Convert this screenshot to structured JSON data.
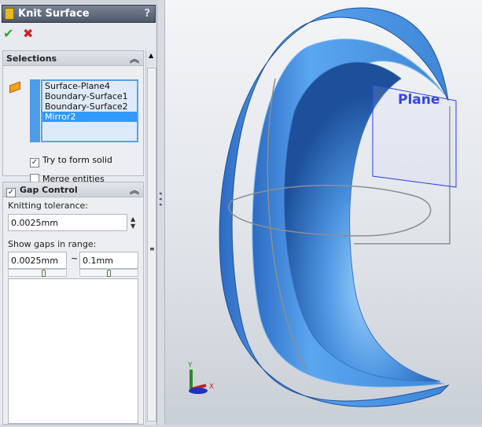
{
  "panel": {
    "title": "Knit Surface",
    "help": "?",
    "ok": "✔",
    "cancel": "✖",
    "selections": {
      "header": "Selections",
      "items": [
        "Surface-Plane4",
        "Boundary-Surface1",
        "Boundary-Surface2",
        "Mirror2"
      ],
      "selected_index": 3,
      "try_solid": "Try to form solid",
      "try_solid_checked": true,
      "merge": "Merge entities",
      "merge_checked": false
    },
    "gap": {
      "header": "Gap Control",
      "enabled": true,
      "tol_label": "Knitting tolerance:",
      "tol_value": "0.0025mm",
      "range_label": "Show gaps in range:",
      "min": "0.0025mm",
      "tilde": "~",
      "max": "0.1mm"
    }
  },
  "viewport": {
    "plane_label": "Plane",
    "axes": {
      "x": "X",
      "y": "Y"
    }
  }
}
